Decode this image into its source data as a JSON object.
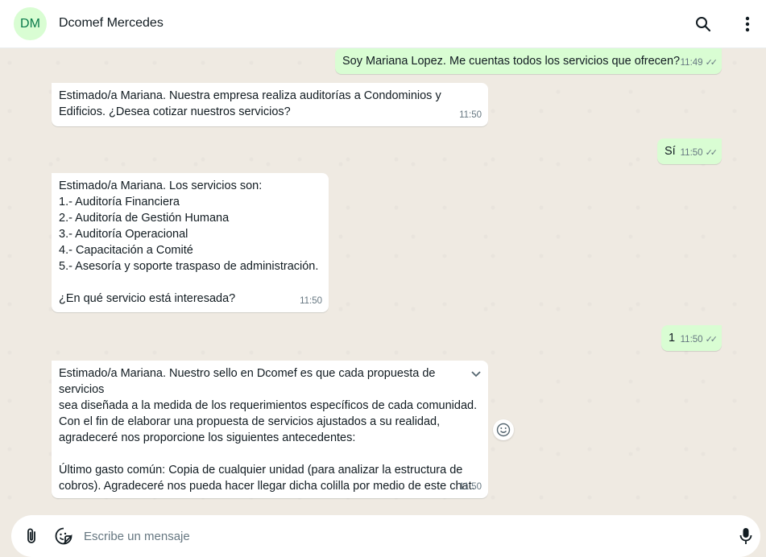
{
  "header": {
    "avatar_initials": "DM",
    "contact_name": "Dcomef Mercedes"
  },
  "messages": [
    {
      "direction": "out",
      "text": "Soy Mariana Lopez. Me cuentas todos los servicios que ofrecen?",
      "time": "11:49",
      "ticks": "✓✓"
    },
    {
      "direction": "in",
      "text": "Estimado/a Mariana. Nuestra empresa realiza auditorías a Condominios y\nEdificios. ¿Desea cotizar nuestros servicios?",
      "time": "11:50"
    },
    {
      "direction": "out",
      "text": "Sí",
      "time": "11:50",
      "ticks": "✓✓"
    },
    {
      "direction": "in",
      "text": "Estimado/a Mariana. Los servicios son:\n1.- Auditoría Financiera\n2.- Auditoría de Gestión Humana\n3.- Auditoría Operacional\n4.- Capacitación a Comité\n5.- Asesoría y soporte traspaso de administración.\n\n¿En qué servicio está interesada?",
      "time": "11:50"
    },
    {
      "direction": "out",
      "text": "1",
      "time": "11:50",
      "ticks": "✓✓"
    },
    {
      "direction": "in",
      "text": "Estimado/a Mariana. Nuestro sello en Dcomef es que cada propuesta de servicios\nsea diseñada a la medida de los requerimientos específicos de cada comunidad.\nCon el fin de elaborar una propuesta de servicios ajustados a su realidad,\nagradeceré nos proporcione los siguientes antecedentes:\n\nÚltimo gasto común: Copia de cualquier unidad (para analizar la estructura de\ncobros). Agradeceré nos pueda hacer llegar dicha colilla por medio de este chat.",
      "time": "11:50"
    }
  ],
  "composer": {
    "placeholder": "Escribe un mensaje"
  },
  "colors": {
    "incoming_bubble": "#ffffff",
    "outgoing_bubble": "#d9fdd3",
    "chat_background": "#efeae2",
    "avatar_bg": "#d9fdd3",
    "avatar_text": "#0a7a4a",
    "read_ticks": "#667781"
  },
  "icons": [
    "search-icon",
    "more-vertical-icon",
    "chevron-down-icon",
    "emoji-icon",
    "paperclip-icon",
    "sticker-icon",
    "mic-icon"
  ]
}
